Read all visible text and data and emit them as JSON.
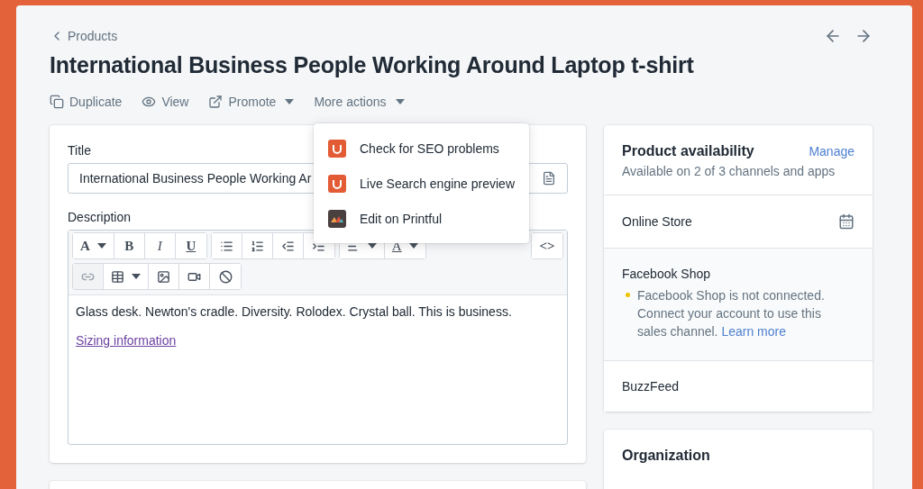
{
  "breadcrumb": {
    "label": "Products"
  },
  "title": "International Business People Working Around Laptop t-shirt",
  "pager": [
    {
      "kind": "previous"
    },
    {
      "kind": "next"
    }
  ],
  "actions": [
    {
      "kind": "duplicate",
      "label": "Duplicate",
      "caret": false
    },
    {
      "kind": "view",
      "label": "View",
      "caret": false
    },
    {
      "kind": "promote",
      "label": "Promote",
      "caret": true
    },
    {
      "kind": "more",
      "label": "More actions",
      "caret": true
    }
  ],
  "dropdown": {
    "items": [
      {
        "kind": "seo",
        "label": "Check for SEO problems"
      },
      {
        "kind": "seo",
        "label": "Live Search engine preview"
      },
      {
        "kind": "printful",
        "label": "Edit on Printful"
      }
    ]
  },
  "product_form": {
    "title_label": "Title",
    "title_value": "International Business People Working Ar",
    "description_label": "Description",
    "toolbar": [
      [
        [
          {
            "kind": "glyph",
            "label": "A",
            "caret": true,
            "disabled": false
          },
          {
            "kind": "glyph",
            "label": "B",
            "caret": false,
            "disabled": false
          },
          {
            "kind": "italic",
            "label": "I",
            "caret": false,
            "disabled": false
          },
          {
            "kind": "underline",
            "label": "U",
            "caret": false,
            "disabled": false
          }
        ],
        [
          {
            "kind": "bullets",
            "caret": false,
            "disabled": false
          },
          {
            "kind": "numbers",
            "caret": false,
            "disabled": false
          },
          {
            "kind": "outdent",
            "caret": false,
            "disabled": false
          },
          {
            "kind": "indent",
            "caret": false,
            "disabled": false
          }
        ],
        [
          {
            "kind": "align",
            "caret": true,
            "disabled": false
          },
          {
            "kind": "color",
            "label": "A",
            "caret": true,
            "disabled": false
          }
        ],
        [
          {
            "kind": "glyph",
            "label": "<>",
            "caret": false,
            "disabled": false
          }
        ]
      ],
      [
        [
          {
            "kind": "link",
            "caret": false,
            "disabled": true
          },
          {
            "kind": "table",
            "caret": true,
            "disabled": false
          },
          {
            "kind": "image",
            "caret": false,
            "disabled": false
          },
          {
            "kind": "video",
            "caret": false,
            "disabled": false
          },
          {
            "kind": "clear",
            "caret": false,
            "disabled": false
          }
        ]
      ]
    ],
    "body": "Glass desk. Newton's cradle. Diversity. Rolodex. Crystal ball. This is business.",
    "body_link": "Sizing information"
  },
  "availability": {
    "title": "Product availability",
    "manage": "Manage",
    "subtitle": "Available on 2 of 3 channels and apps",
    "channels": [
      {
        "name": "Online Store",
        "kind": "scheduled"
      },
      {
        "name": "Facebook Shop",
        "kind": "notice",
        "note": "Facebook Shop is not connected. Connect your account to use this sales channel.",
        "link": "Learn more",
        "color": "#eec200"
      },
      {
        "name": "BuzzFeed",
        "kind": "plain"
      }
    ]
  },
  "organization": {
    "title": "Organization"
  }
}
